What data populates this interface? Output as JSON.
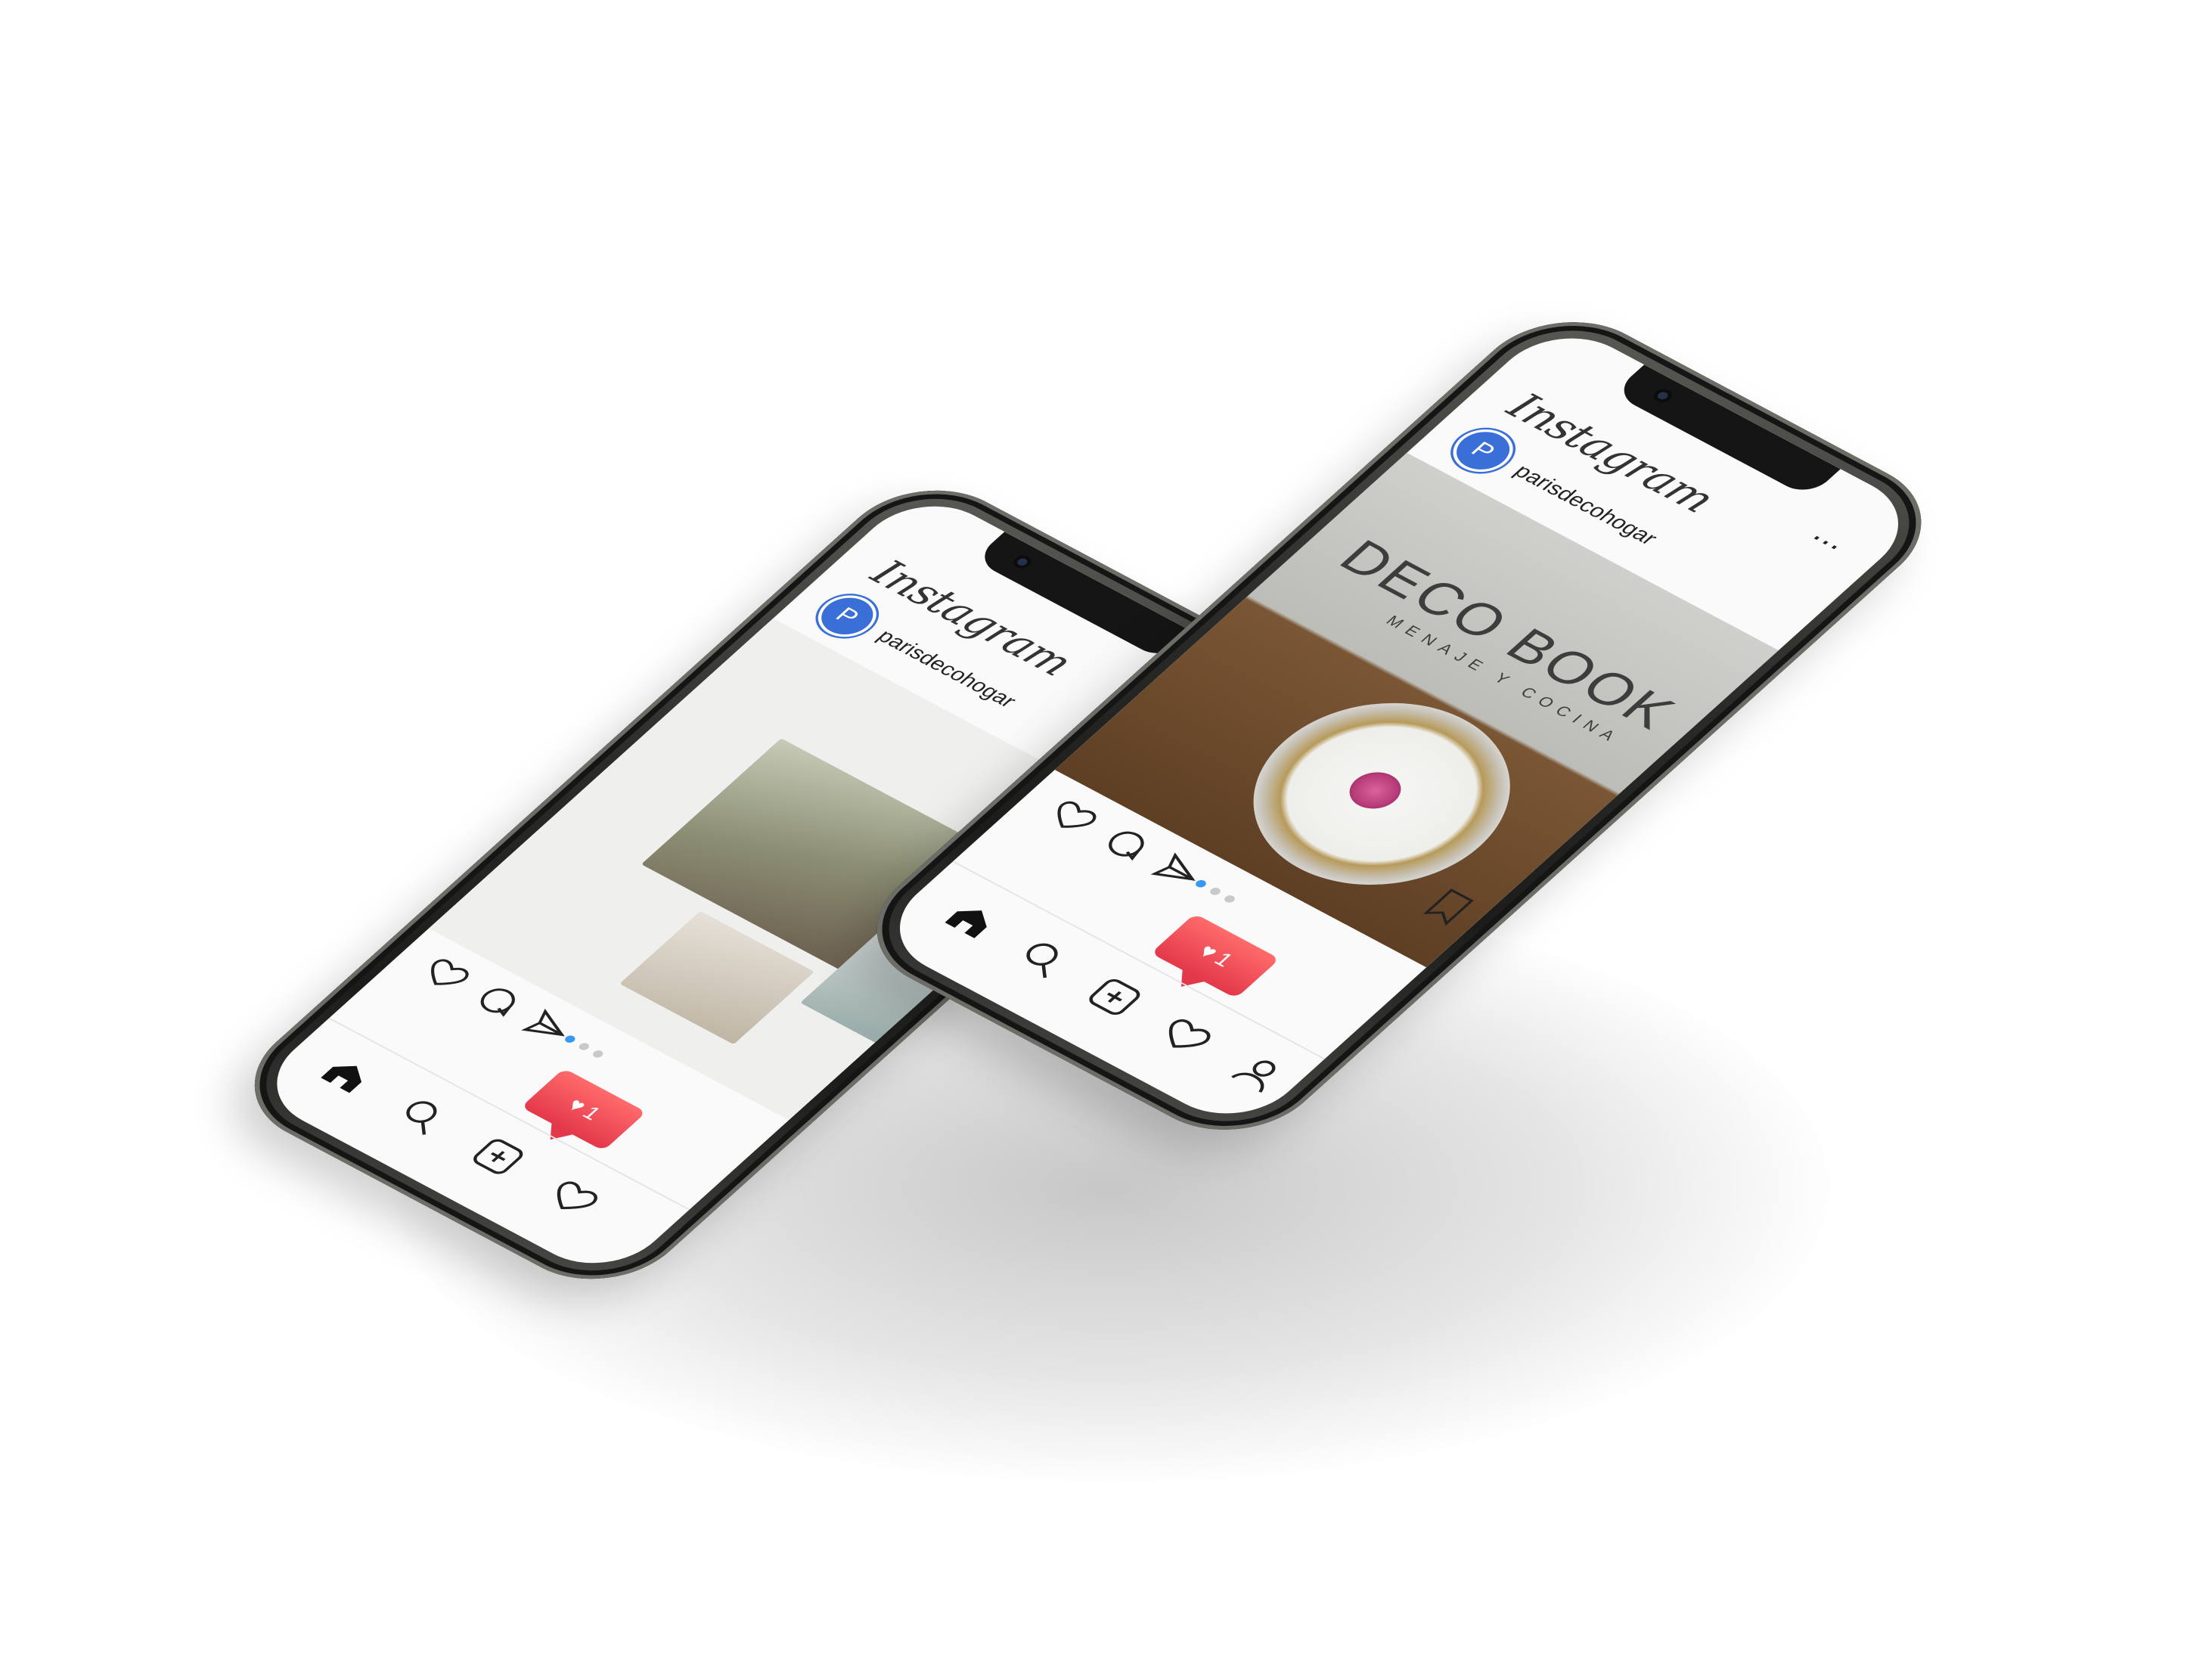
{
  "app": {
    "title": "Instagram",
    "username": "parisdecohogar",
    "avatar_letter": "P"
  },
  "colors": {
    "accent": "#3b6fd8",
    "like": "#e3384a",
    "dot_active": "#3897f0"
  },
  "post_back": {
    "carousel_total": 3,
    "carousel_active": 1
  },
  "post_front": {
    "brand": "DECO BOOK",
    "tagline": "MENAJE Y COCINA",
    "carousel_total": 3,
    "carousel_active": 1
  },
  "notification": {
    "icon": "heart-icon",
    "count": "1"
  },
  "nav": [
    "home-icon",
    "search-icon",
    "add-post-icon",
    "activity-heart-icon",
    "profile-icon"
  ]
}
